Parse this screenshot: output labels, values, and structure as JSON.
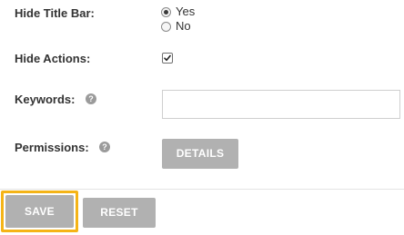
{
  "form": {
    "hide_title_bar": {
      "label": "Hide Title Bar:",
      "options": [
        {
          "label": "Yes",
          "checked": true
        },
        {
          "label": "No",
          "checked": false
        }
      ]
    },
    "hide_actions": {
      "label": "Hide Actions:",
      "checked": true
    },
    "keywords": {
      "label": "Keywords:",
      "help_icon": "question-mark-icon",
      "help_glyph": "?",
      "value": "",
      "placeholder": ""
    },
    "permissions": {
      "label": "Permissions:",
      "help_icon": "question-mark-icon",
      "help_glyph": "?",
      "details_button": "DETAILS"
    }
  },
  "footer": {
    "save_button": "SAVE",
    "reset_button": "RESET"
  },
  "colors": {
    "button_bg": "#b1b1b1",
    "focus_outline": "#f5b417",
    "help_icon_bg": "#9b9b9b",
    "label_text": "#333333"
  }
}
